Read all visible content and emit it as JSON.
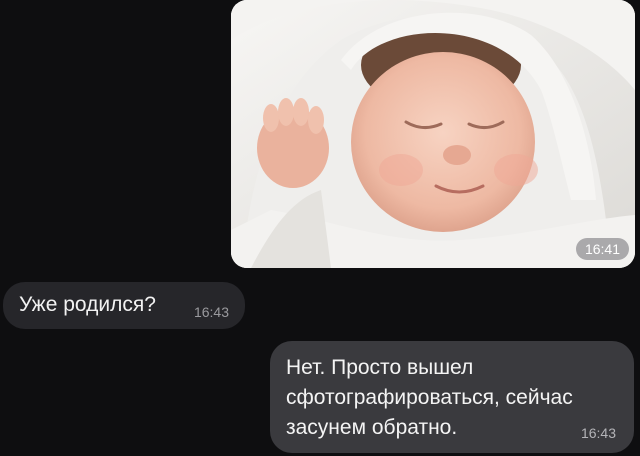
{
  "messages": {
    "photo": {
      "time": "16:41"
    },
    "incoming": {
      "text": "Уже родился?",
      "time": "16:43"
    },
    "outgoing": {
      "lines": [
        "Нет. Просто вышел",
        "сфотографироваться, сейчас",
        "засунем обратно."
      ],
      "time": "16:43"
    }
  },
  "colors": {
    "background": "#0e0e10",
    "incoming_bubble": "#26262a",
    "outgoing_bubble": "#3a3a3e"
  }
}
